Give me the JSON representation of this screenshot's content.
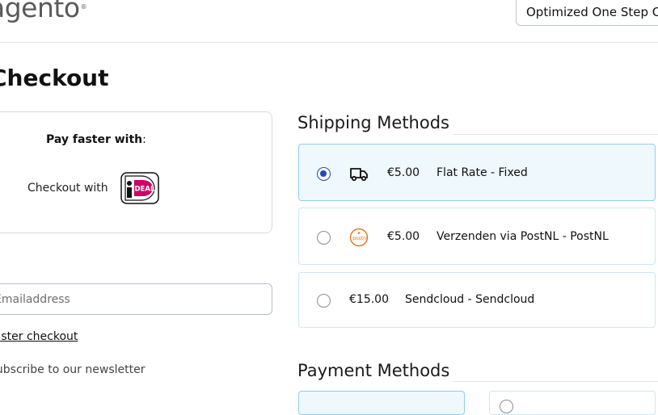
{
  "header": {
    "logo_text": "agento",
    "logo_reg": "®",
    "top_button_label": "Optimized One Step Checkout"
  },
  "page": {
    "title": "Checkout"
  },
  "pay_faster": {
    "title": "Pay faster with",
    "title_suffix": ":",
    "checkout_with": "Checkout with",
    "ideal_logo_text": "DEAL"
  },
  "email": {
    "placeholder": "Emailaddress"
  },
  "links": {
    "faster_checkout": "Faster checkout",
    "newsletter": "Subscribe to our newsletter"
  },
  "shipping": {
    "title": "Shipping Methods",
    "methods": [
      {
        "price": "€5.00",
        "name": "Flat Rate - Fixed",
        "icon": "truck-icon",
        "selected": true
      },
      {
        "price": "€5.00",
        "name": "Verzenden via PostNL - PostNL",
        "icon": "postnl-icon",
        "selected": false
      },
      {
        "price": "€15.00",
        "name": "Sendcloud - Sendcloud",
        "icon": "",
        "selected": false
      }
    ]
  },
  "payment": {
    "title": "Payment Methods"
  },
  "colors": {
    "selected_bg": "#eef8fd",
    "selected_border": "#8fd0e6",
    "radio_accent": "#2349b8",
    "postnl_orange": "#e8731f"
  }
}
